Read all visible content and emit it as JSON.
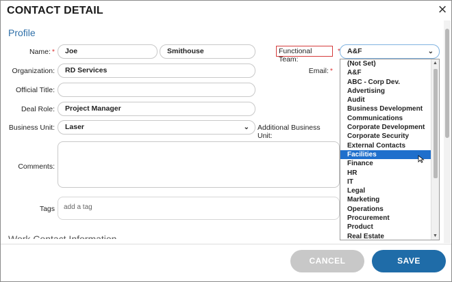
{
  "dialog": {
    "title": "CONTACT DETAIL",
    "close_icon": "×"
  },
  "profile": {
    "section_title": "Profile",
    "name_label": "Name:",
    "first_name": "Joe",
    "last_name": "Smithouse",
    "organization_label": "Organization:",
    "organization": "RD Services",
    "official_title_label": "Official Title:",
    "official_title": "",
    "deal_role_label": "Deal Role:",
    "deal_role": "Project Manager",
    "business_unit_label": "Business Unit:",
    "business_unit": "Laser",
    "additional_business_unit_label": "Additional Business Unit:",
    "comments_label": "Comments:",
    "tags_label": "Tags",
    "tags_placeholder": "add a tag",
    "functional_team_label": "Functional Team:",
    "functional_team": "A&F",
    "email_label": "Email:",
    "required_mark": "*"
  },
  "dropdown": {
    "options": [
      "(Not Set)",
      "A&F",
      "ABC - Corp Dev.",
      "Advertising",
      "Audit",
      "Business Development",
      "Communications",
      "Corporate Development",
      "Corporate Security",
      "External Contacts",
      "Facilities",
      "Finance",
      "HR",
      "IT",
      "Legal",
      "Marketing",
      "Operations",
      "Procurement",
      "Product",
      "Real Estate"
    ],
    "highlighted": "Facilities"
  },
  "next_section": "Work Contact Information",
  "footer": {
    "cancel_label": "CANCEL",
    "save_label": "SAVE"
  },
  "colors": {
    "accent": "#1f6ca8",
    "highlight": "#1f6fcc",
    "required": "#d33333"
  }
}
